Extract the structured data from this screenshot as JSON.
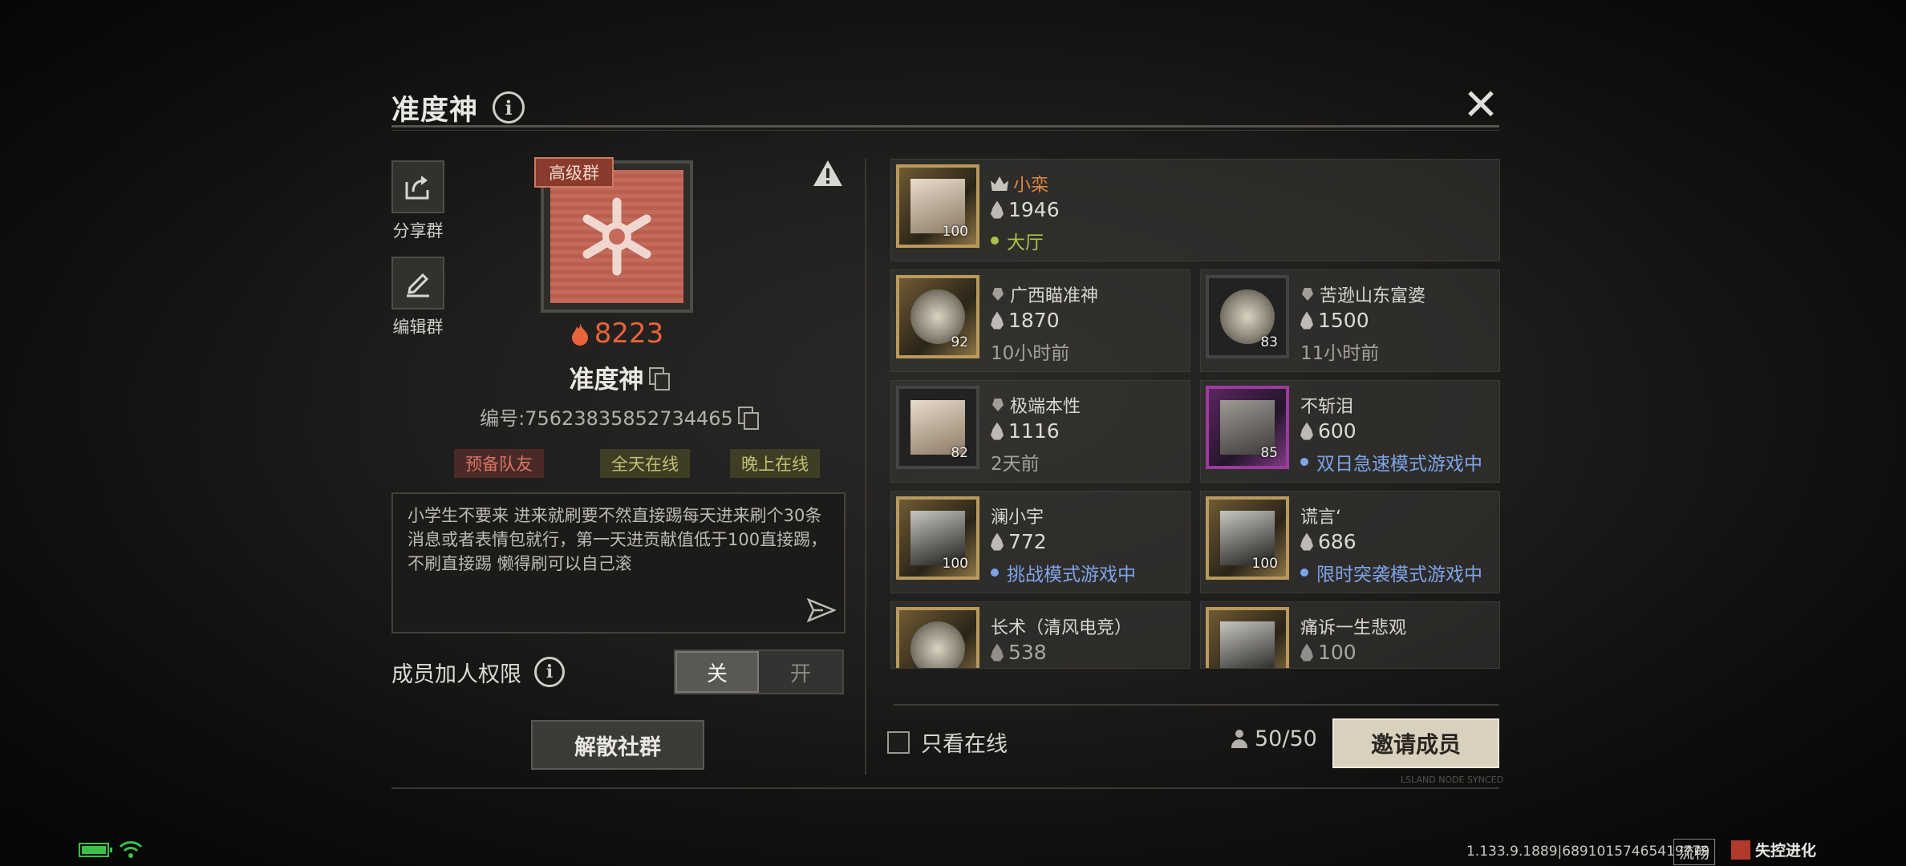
{
  "dialog": {
    "title": "准度神",
    "close_symbol": "✕"
  },
  "sidebar": {
    "share_label": "分享群",
    "edit_label": "编辑群"
  },
  "group": {
    "tier_badge": "高级群",
    "heat": "8223",
    "name": "准度神",
    "id_text": "编号:75623835852734465",
    "tags": [
      "预备队友",
      "全天在线",
      "晚上在线"
    ],
    "description": "小学生不要来 进来就刷要不然直接踢每天进来刷个30条消息或者表情包就行，第一天进贡献值低于100直接踢，不刷直接踢 懒得刷可以自己滚"
  },
  "permission": {
    "label": "成员加人权限",
    "off_label": "关",
    "on_label": "开",
    "selected": "关"
  },
  "actions": {
    "dissolve_label": "解散社群",
    "online_only_label": "只看在线",
    "member_count": "50/50",
    "invite_label": "邀请成员"
  },
  "members": [
    {
      "name": "小栾",
      "heat": "1946",
      "level": "100",
      "status": "大厅",
      "status_type": "lobby",
      "role": "leader"
    },
    {
      "name": "广西瞄准神",
      "heat": "1870",
      "level": "92",
      "status": "10小时前",
      "status_type": "offline",
      "role": "member"
    },
    {
      "name": "苦逊山东富婆",
      "heat": "1500",
      "level": "83",
      "status": "11小时前",
      "status_type": "offline",
      "role": "member"
    },
    {
      "name": "极端本性",
      "heat": "1116",
      "level": "82",
      "status": "2天前",
      "status_type": "offline",
      "role": "member"
    },
    {
      "name": "不斩泪",
      "heat": "600",
      "level": "85",
      "status": "双日急速模式游戏中",
      "status_type": "ingame",
      "role": "none"
    },
    {
      "name": "澜小宇",
      "heat": "772",
      "level": "100",
      "status": "挑战模式游戏中",
      "status_type": "ingame",
      "role": "none"
    },
    {
      "name": "谎言‘",
      "heat": "686",
      "level": "100",
      "status": "限时突袭模式游戏中",
      "status_type": "ingame",
      "role": "none"
    },
    {
      "name": "长术（清风电竞）",
      "heat": "538",
      "level": "",
      "status": "",
      "status_type": "offline",
      "role": "none"
    },
    {
      "name": "痛诉一生悲观",
      "heat": "100",
      "level": "",
      "status": "",
      "status_type": "offline",
      "role": "none"
    }
  ],
  "footer": {
    "sync_label": "LSLAND NODE SYNCED",
    "version": "1.133.9.1889|68910157465419779",
    "quality": "流畅",
    "game_name": "失控进化"
  },
  "colors": {
    "accent_fire": "#e8633a",
    "leader_name": "#e0883f",
    "lobby_status": "#a8c24a",
    "ingame_status": "#7ea4e8",
    "tier_badge_bg": "#8a3b2d"
  }
}
